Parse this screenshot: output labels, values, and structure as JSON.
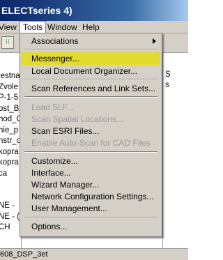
{
  "window": {
    "title": "ELECTseries 4)"
  },
  "menubar": {
    "items": [
      {
        "label": "View"
      },
      {
        "label": "Tools"
      },
      {
        "label": "Window"
      },
      {
        "label": "Help"
      }
    ]
  },
  "left_pane": {
    "rows": [
      "iestna",
      "Zvole",
      "P-1-5",
      "ost_B",
      "hod_C",
      "nie_p",
      "nstr_c",
      "kopra",
      "kopra",
      "ca",
      "",
      "",
      "NE -",
      "NE - (",
      "CH",
      "",
      "",
      "",
      "608_DSP_3et"
    ]
  },
  "right_pane": {
    "rows": [
      "S",
      "s"
    ]
  },
  "tools_menu": {
    "items": [
      {
        "label": "Associations",
        "enabled": true,
        "has_submenu": true
      },
      {
        "label": "Messenger...",
        "enabled": true,
        "highlighted": true
      },
      {
        "label": "Local Document Organizer...",
        "enabled": true
      },
      {
        "label": "Scan References and Link Sets...",
        "enabled": true
      },
      {
        "label": "Load SLF...",
        "enabled": false
      },
      {
        "label": "Scan Spatial Locations...",
        "enabled": false
      },
      {
        "label": "Scan ESRI Files...",
        "enabled": true
      },
      {
        "label": "Enable Auto-Scan for CAD Files",
        "enabled": false
      },
      {
        "label": "Customize...",
        "enabled": true
      },
      {
        "label": "Interface...",
        "enabled": true
      },
      {
        "label": "Wizard Manager...",
        "enabled": true
      },
      {
        "label": "Network Configuration Settings...",
        "enabled": true
      },
      {
        "label": "User Management...",
        "enabled": true
      },
      {
        "label": "Options...",
        "enabled": true
      }
    ],
    "highlight_color": "#e3dc2e",
    "disabled_color": "#9a9a9a"
  }
}
